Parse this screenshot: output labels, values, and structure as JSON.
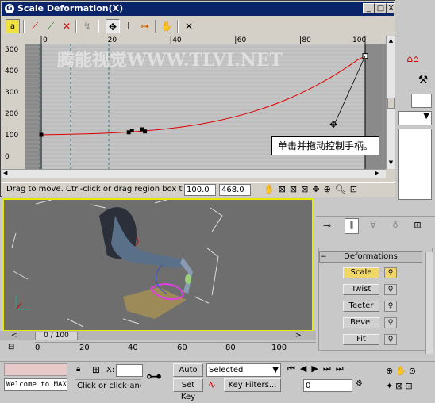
{
  "window": {
    "title": "Scale Deformation(X)",
    "icon": "max-icon",
    "controls": [
      "_",
      "□",
      "X"
    ]
  },
  "toolbar": {
    "icons": [
      "lock-icon",
      "curve-red-icon",
      "curve-green-icon",
      "curve-both-icon",
      "swap-icon",
      "move-icon",
      "scale-vertical-icon",
      "insert-point-icon",
      "pan-hand-icon",
      "delete-point-icon"
    ]
  },
  "graph": {
    "x_ticks": [
      "0",
      "20",
      "40",
      "60",
      "80",
      "100"
    ],
    "y_ticks": [
      "500",
      "400",
      "300",
      "200",
      "100",
      "0"
    ],
    "watermark": "腾能视觉WWW.TLVI.NET",
    "curve_color": "#e00000"
  },
  "callout": "单击并拖动控制手柄。",
  "status": {
    "hint": "Drag to move. Ctrl-click or drag region box to add to s",
    "x_value": "100.0",
    "y_value": "468.0"
  },
  "deformations": {
    "title": "Deformations",
    "buttons": [
      "Scale",
      "Twist",
      "Teeter",
      "Bevel",
      "Fit"
    ]
  },
  "timeline": {
    "slider": "0 / 100",
    "ruler": [
      "0",
      "20",
      "40",
      "60",
      "80",
      "100"
    ]
  },
  "bottom": {
    "welcome": "Welcome to MAX!",
    "prompt": "Click or click-and-dra",
    "x_label": "X:",
    "auto_key": "Auto Key",
    "set_key": "Set Key",
    "selected": "Selected",
    "key_filters": "Key Filters...",
    "frame": "0"
  }
}
